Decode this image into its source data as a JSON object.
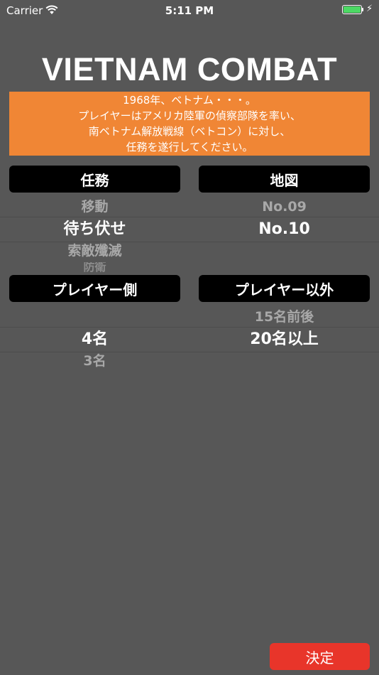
{
  "status": {
    "carrier": "Carrier",
    "time": "5:11 PM"
  },
  "title": "VIETNAM COMBAT",
  "intro": {
    "lines": [
      "1968年、ベトナム・・・。",
      "プレイヤーはアメリカ陸軍の偵察部隊を率い、",
      "南ベトナム解放戦線（ベトコン）に対し、",
      "任務を遂行してください。"
    ]
  },
  "headers": {
    "mission": "任務",
    "map": "地図",
    "player": "プレイヤー側",
    "enemy": "プレイヤー以外"
  },
  "pickers": {
    "mission": {
      "above": "移動",
      "selected": "待ち伏せ",
      "below": "索敵殲滅",
      "below2": "防衛"
    },
    "map": {
      "above": "No.09",
      "selected": "No.10"
    },
    "player": {
      "selected": "4名",
      "below": "3名"
    },
    "enemy": {
      "above": "15名前後",
      "selected": "20名以上"
    }
  },
  "confirm_label": "決定",
  "colors": {
    "background": "#575757",
    "banner": "#f08635",
    "confirm": "#e8352a",
    "battery": "#4cd964"
  }
}
